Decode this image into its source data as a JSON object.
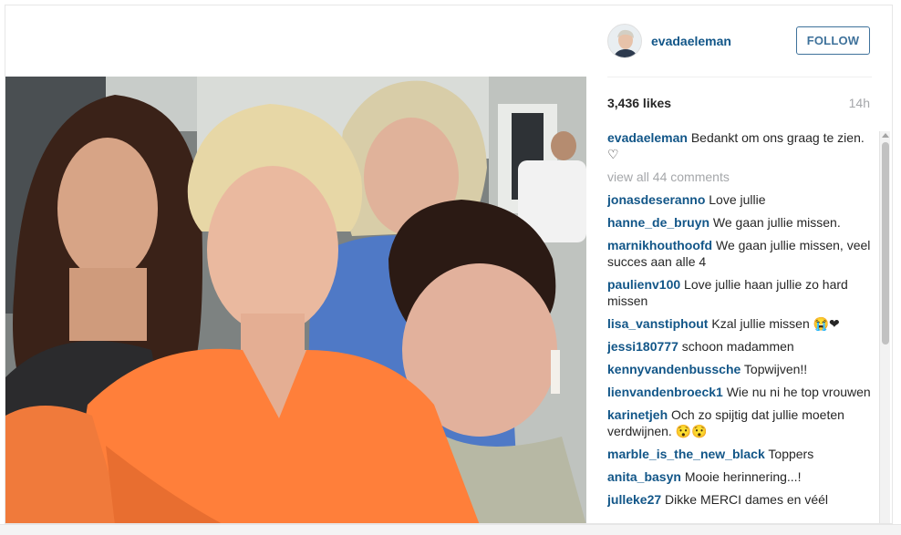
{
  "post": {
    "username": "evadaeleman",
    "follow_label": "FOLLOW",
    "likes": "3,436 likes",
    "time": "14h",
    "caption_user": "evadaeleman",
    "caption_text": " Bedankt om ons graag te zien. ♡",
    "view_all": "view all 44 comments"
  },
  "comments": [
    {
      "user": "jonasdeseranno",
      "text": " Love jullie"
    },
    {
      "user": "hanne_de_bruyn",
      "text": " We gaan jullie missen."
    },
    {
      "user": "marnikhouthoofd",
      "text": " We gaan jullie missen, veel succes aan alle 4"
    },
    {
      "user": "paulienv100",
      "text": " Love jullie haan jullie zo hard missen"
    },
    {
      "user": "lisa_vanstiphout",
      "text": " Kzal jullie missen 😭❤"
    },
    {
      "user": "jessi180777",
      "text": " schoon madammen"
    },
    {
      "user": "kennyvandenbussche",
      "text": " Topwijven!!"
    },
    {
      "user": "lienvandenbroeck1",
      "text": " Wie nu ni he top vrouwen"
    },
    {
      "user": "karinetjeh",
      "text": " Och zo spijtig dat jullie moeten verdwijnen. 😯😯"
    },
    {
      "user": "marble_is_the_new_black",
      "text": " Toppers"
    },
    {
      "user": "anita_basyn",
      "text": " Mooie herinnering...!"
    },
    {
      "user": "julleke27",
      "text": " Dikke MERCI dames en véél"
    }
  ],
  "colors": {
    "link": "#125688",
    "follow": "#3f729b",
    "muted": "#a5a7aa"
  },
  "icons": {
    "avatar": "profile-avatar"
  }
}
